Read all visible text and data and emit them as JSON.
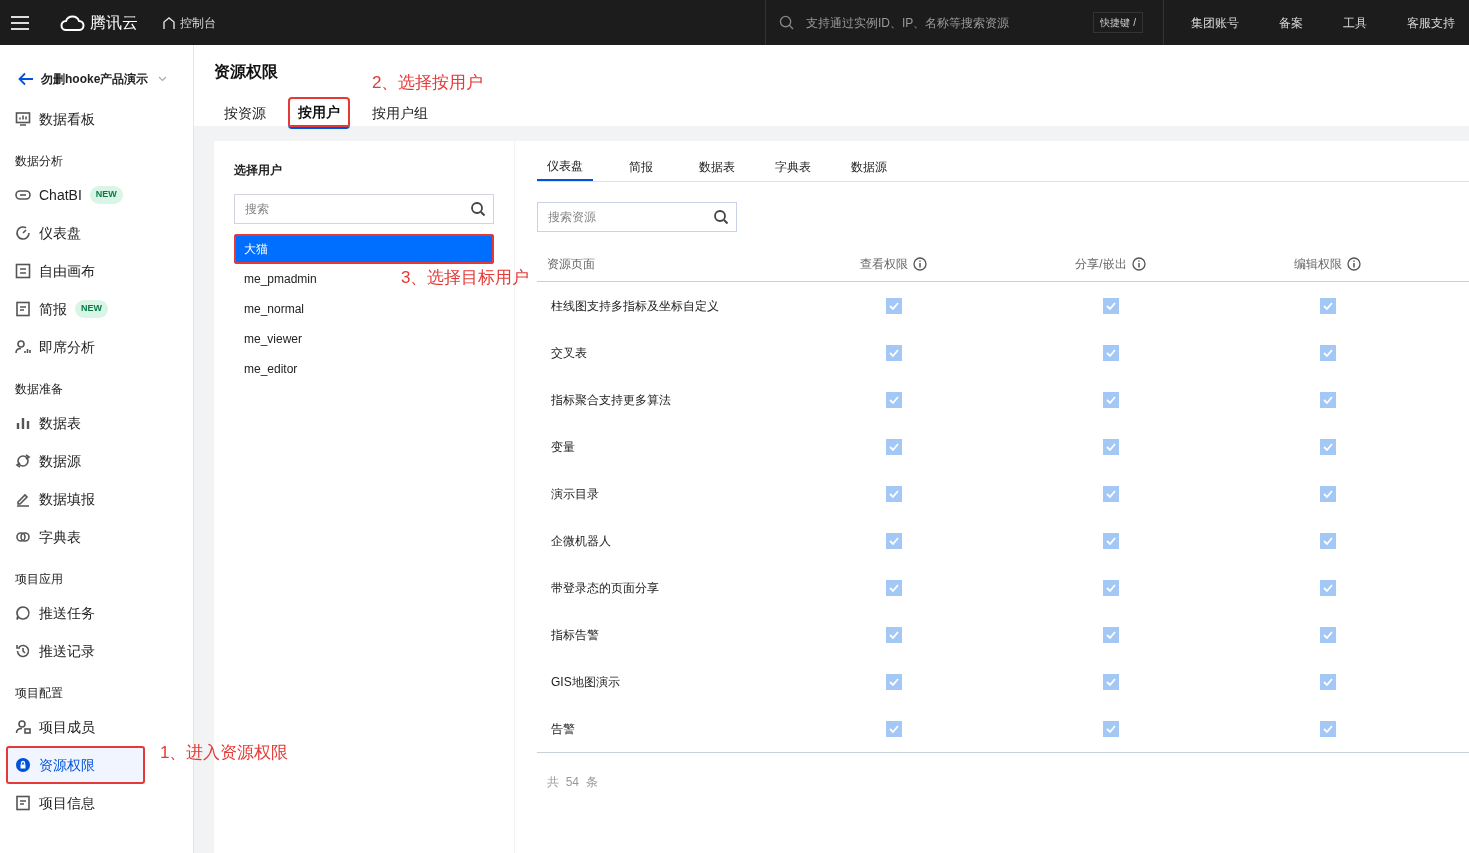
{
  "topbar": {
    "brand": "腾讯云",
    "console": "控制台",
    "search_placeholder": "支持通过实例ID、IP、名称等搜索资源",
    "shortcut": "快捷键 /",
    "links": [
      "集团账号",
      "备案",
      "工具",
      "客服支持"
    ]
  },
  "sidebar": {
    "project": "勿删hooke产品演示",
    "groups": [
      {
        "items": [
          {
            "label": "数据看板",
            "kind": "monitor",
            "selected": false,
            "highlighted": false
          }
        ]
      },
      {
        "title": "数据分析",
        "items": [
          {
            "label": "ChatBI",
            "kind": "chat",
            "badge": "NEW",
            "selected": false,
            "highlighted": false
          },
          {
            "label": "仪表盘",
            "kind": "gauge",
            "selected": false,
            "highlighted": false
          },
          {
            "label": "自由画布",
            "kind": "canvas",
            "selected": false,
            "highlighted": false
          },
          {
            "label": "简报",
            "kind": "doc",
            "badge": "NEW",
            "selected": false,
            "highlighted": false
          },
          {
            "label": "即席分析",
            "kind": "userchart",
            "selected": false,
            "highlighted": false
          }
        ]
      },
      {
        "title": "数据准备",
        "items": [
          {
            "label": "数据表",
            "kind": "bars",
            "selected": false,
            "highlighted": false
          },
          {
            "label": "数据源",
            "kind": "source",
            "selected": false,
            "highlighted": false
          },
          {
            "label": "数据填报",
            "kind": "pen",
            "selected": false,
            "highlighted": false
          },
          {
            "label": "字典表",
            "kind": "link",
            "selected": false,
            "highlighted": false
          }
        ]
      },
      {
        "title": "项目应用",
        "items": [
          {
            "label": "推送任务",
            "kind": "bubble",
            "selected": false,
            "highlighted": false
          },
          {
            "label": "推送记录",
            "kind": "history",
            "selected": false,
            "highlighted": false
          }
        ]
      },
      {
        "title": "项目配置",
        "items": [
          {
            "label": "项目成员",
            "kind": "user",
            "selected": false,
            "highlighted": false
          },
          {
            "label": "资源权限",
            "kind": "lock",
            "selected": true,
            "highlighted": true
          },
          {
            "label": "项目信息",
            "kind": "doc",
            "selected": false,
            "highlighted": false
          }
        ]
      }
    ]
  },
  "page": {
    "title": "资源权限",
    "tabs": [
      {
        "label": "按资源",
        "selected": false,
        "highlighted": false
      },
      {
        "label": "按用户",
        "selected": true,
        "highlighted": true
      },
      {
        "label": "按用户组",
        "selected": false,
        "highlighted": false
      }
    ]
  },
  "users": {
    "title": "选择用户",
    "placeholder": "搜索",
    "items": [
      {
        "name": "大猫",
        "selected": true,
        "highlighted": true
      },
      {
        "name": "me_pmadmin",
        "selected": false,
        "highlighted": false
      },
      {
        "name": "me_normal",
        "selected": false,
        "highlighted": false
      },
      {
        "name": "me_viewer",
        "selected": false,
        "highlighted": false
      },
      {
        "name": "me_editor",
        "selected": false,
        "highlighted": false
      }
    ]
  },
  "resources": {
    "tabs": [
      {
        "label": "仪表盘",
        "selected": true
      },
      {
        "label": "简报",
        "selected": false
      },
      {
        "label": "数据表",
        "selected": false
      },
      {
        "label": "字典表",
        "selected": false
      },
      {
        "label": "数据源",
        "selected": false
      }
    ],
    "placeholder": "搜索资源",
    "columns": [
      "资源页面",
      "查看权限",
      "分享/嵌出",
      "编辑权限"
    ],
    "disabled": true,
    "rows": [
      {
        "name": "柱线图支持多指标及坐标自定义",
        "view": true,
        "share": true,
        "edit": true
      },
      {
        "name": "交叉表",
        "view": true,
        "share": true,
        "edit": true
      },
      {
        "name": "指标聚合支持更多算法",
        "view": true,
        "share": true,
        "edit": true
      },
      {
        "name": "变量",
        "view": true,
        "share": true,
        "edit": true
      },
      {
        "name": "演示目录",
        "view": true,
        "share": true,
        "edit": true
      },
      {
        "name": "企微机器人",
        "view": true,
        "share": true,
        "edit": true
      },
      {
        "name": "带登录态的页面分享",
        "view": true,
        "share": true,
        "edit": true
      },
      {
        "name": "指标告警",
        "view": true,
        "share": true,
        "edit": true
      },
      {
        "name": "GIS地图演示",
        "view": true,
        "share": true,
        "edit": true
      },
      {
        "name": "告警",
        "view": true,
        "share": true,
        "edit": true
      }
    ],
    "total": "共  54  条"
  },
  "annotations": [
    "1、进入资源权限",
    "2、选择按用户",
    "3、选择目标用户"
  ]
}
